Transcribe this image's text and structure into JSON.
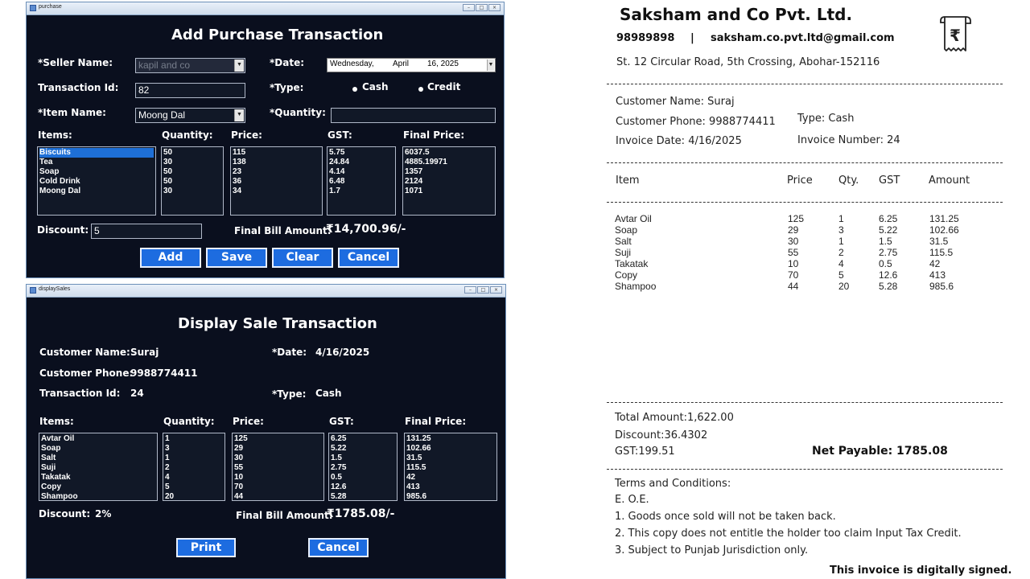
{
  "purchase": {
    "window_title": "purchase",
    "heading": "Add Purchase Transaction",
    "seller_label": "*Seller Name:",
    "seller_value": "kapil and co",
    "date_label": "*Date:",
    "date_weekday": "Wednesday,",
    "date_month": "April",
    "date_rest": "16, 2025",
    "txn_label": "Transaction Id:",
    "txn_value": "82",
    "type_label": "*Type:",
    "type_cash": "Cash",
    "type_credit": "Credit",
    "item_label": "*Item Name:",
    "item_value": "Moong Dal",
    "qty_label": "*Quantity:",
    "qty_value": "",
    "col_items": "Items:",
    "col_qty": "Quantity:",
    "col_price": "Price:",
    "col_gst": "GST:",
    "col_final": "Final Price:",
    "items": [
      "Biscuits",
      "Tea",
      "Soap",
      "Cold Drink",
      "Moong Dal"
    ],
    "quantities": [
      "50",
      "30",
      "50",
      "50",
      "30"
    ],
    "prices": [
      "115",
      "138",
      "23",
      "36",
      "34"
    ],
    "gst": [
      "5.75",
      "24.84",
      "4.14",
      "6.48",
      "1.7"
    ],
    "final_prices": [
      "6037.5",
      "4885.19971",
      "1357",
      "2124",
      "1071"
    ],
    "discount_label": "Discount:",
    "discount_value": "5",
    "final_bill_label": "Final Bill Amount:",
    "final_bill_value": "₹14,700.96/-",
    "btn_add": "Add",
    "btn_save": "Save",
    "btn_clear": "Clear",
    "btn_cancel": "Cancel"
  },
  "sales": {
    "window_title": "displaySales",
    "heading": "Display Sale Transaction",
    "customer_name_label": "Customer Name:",
    "customer_name": "Suraj",
    "date_label": "*Date:",
    "date_value": "4/16/2025",
    "customer_phone_label": "Customer Phone:",
    "customer_phone": "9988774411",
    "txn_label": "Transaction Id:",
    "txn_value": "24",
    "type_label": "*Type:",
    "type_value": "Cash",
    "col_items": "Items:",
    "col_qty": "Quantity:",
    "col_price": "Price:",
    "col_gst": "GST:",
    "col_final": "Final Price:",
    "items": [
      "Avtar Oil",
      "Soap",
      "Salt",
      "Suji",
      "Takatak",
      "Copy",
      "Shampoo"
    ],
    "quantities": [
      "1",
      "3",
      "1",
      "2",
      "4",
      "5",
      "20"
    ],
    "prices": [
      "125",
      "29",
      "30",
      "55",
      "10",
      "70",
      "44"
    ],
    "gst": [
      "6.25",
      "5.22",
      "1.5",
      "2.75",
      "0.5",
      "12.6",
      "5.28"
    ],
    "final_prices": [
      "131.25",
      "102.66",
      "31.5",
      "115.5",
      "42",
      "413",
      "985.6"
    ],
    "discount_label": "Discount:",
    "discount_value": "2%",
    "final_bill_label": "Final Bill Amount:",
    "final_bill_value": "₹1785.08/-",
    "btn_print": "Print",
    "btn_cancel": "Cancel"
  },
  "invoice": {
    "company": "Saksham and Co Pvt. Ltd.",
    "phone": "98989898",
    "separator": "|",
    "email": "saksham.co.pvt.ltd@gmail.com",
    "address": "St. 12 Circular Road, 5th Crossing, Abohar-152116",
    "customer_name": "Customer Name: Suraj",
    "customer_phone": "Customer Phone: 9988774411",
    "type": "Type: Cash",
    "invoice_date": "Invoice Date: 4/16/2025",
    "invoice_number": "Invoice Number: 24",
    "col_item": "Item",
    "col_price": "Price",
    "col_qty": "Qty.",
    "col_gst": "GST",
    "col_amount": "Amount",
    "rows": [
      {
        "item": "Avtar Oil",
        "price": "125",
        "qty": "1",
        "gst": "6.25",
        "amount": "131.25"
      },
      {
        "item": "Soap",
        "price": "29",
        "qty": "3",
        "gst": "5.22",
        "amount": "102.66"
      },
      {
        "item": "Salt",
        "price": "30",
        "qty": "1",
        "gst": "1.5",
        "amount": "31.5"
      },
      {
        "item": "Suji",
        "price": "55",
        "qty": "2",
        "gst": "2.75",
        "amount": "115.5"
      },
      {
        "item": "Takatak",
        "price": "10",
        "qty": "4",
        "gst": "0.5",
        "amount": "42"
      },
      {
        "item": "Copy",
        "price": "70",
        "qty": "5",
        "gst": "12.6",
        "amount": "413"
      },
      {
        "item": "Shampoo",
        "price": "44",
        "qty": "20",
        "gst": "5.28",
        "amount": "985.6"
      }
    ],
    "total_amount": "Total Amount:1,622.00",
    "discount": "Discount:36.4302",
    "gst": "GST:199.51",
    "net_payable": "Net Payable: 1785.08",
    "terms_title": "Terms and Conditions:",
    "terms": [
      "E. O.E.",
      "1. Goods once sold will not be taken back.",
      "2. This copy does not entitle the holder too claim Input Tax Credit.",
      "3. Subject to Punjab Jurisdiction only."
    ],
    "signed_note": "This invoice is digitally signed.",
    "icon": "rupee-receipt-icon"
  },
  "colors": {
    "window_bg": "#0a0f1e",
    "button_blue": "#1d6ce0",
    "selection_blue": "#1e6fd6"
  }
}
